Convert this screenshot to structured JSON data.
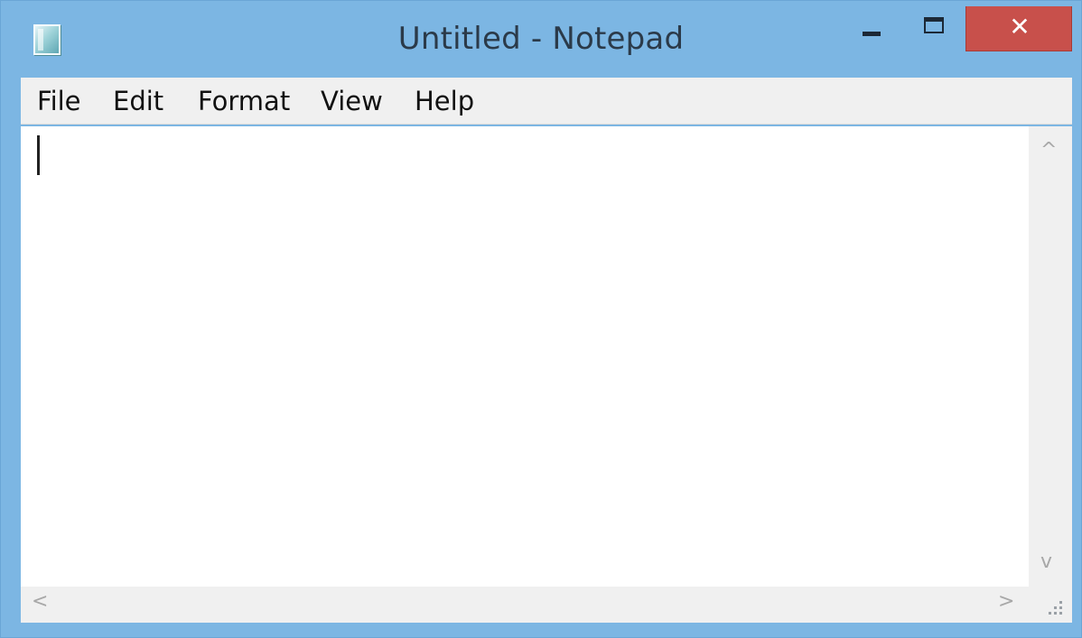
{
  "window": {
    "title": "Untitled - Notepad",
    "icon": "notepad-app-icon",
    "controls": {
      "minimize": "minimize-icon",
      "maximize": "maximize-icon",
      "close_label": "✕"
    },
    "colors": {
      "frame": "#7cb6e3",
      "close_button": "#c8504b"
    }
  },
  "menu": {
    "items": [
      {
        "label": "File"
      },
      {
        "label": "Edit"
      },
      {
        "label": "Format"
      },
      {
        "label": "View"
      },
      {
        "label": "Help"
      }
    ]
  },
  "editor": {
    "content": ""
  },
  "scrollbars": {
    "up": "^",
    "down": "v",
    "left": "<",
    "right": ">"
  }
}
